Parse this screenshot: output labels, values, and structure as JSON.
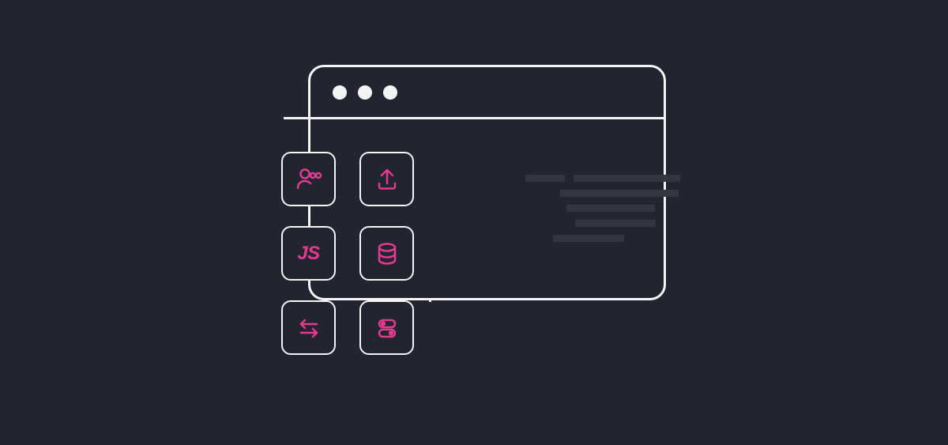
{
  "colors": {
    "background": "#22252f",
    "line_stroke": "#f5f5f5",
    "accent": "#e33a8f",
    "text_placeholder": "#333640"
  },
  "features": {
    "js_label": "JS"
  }
}
